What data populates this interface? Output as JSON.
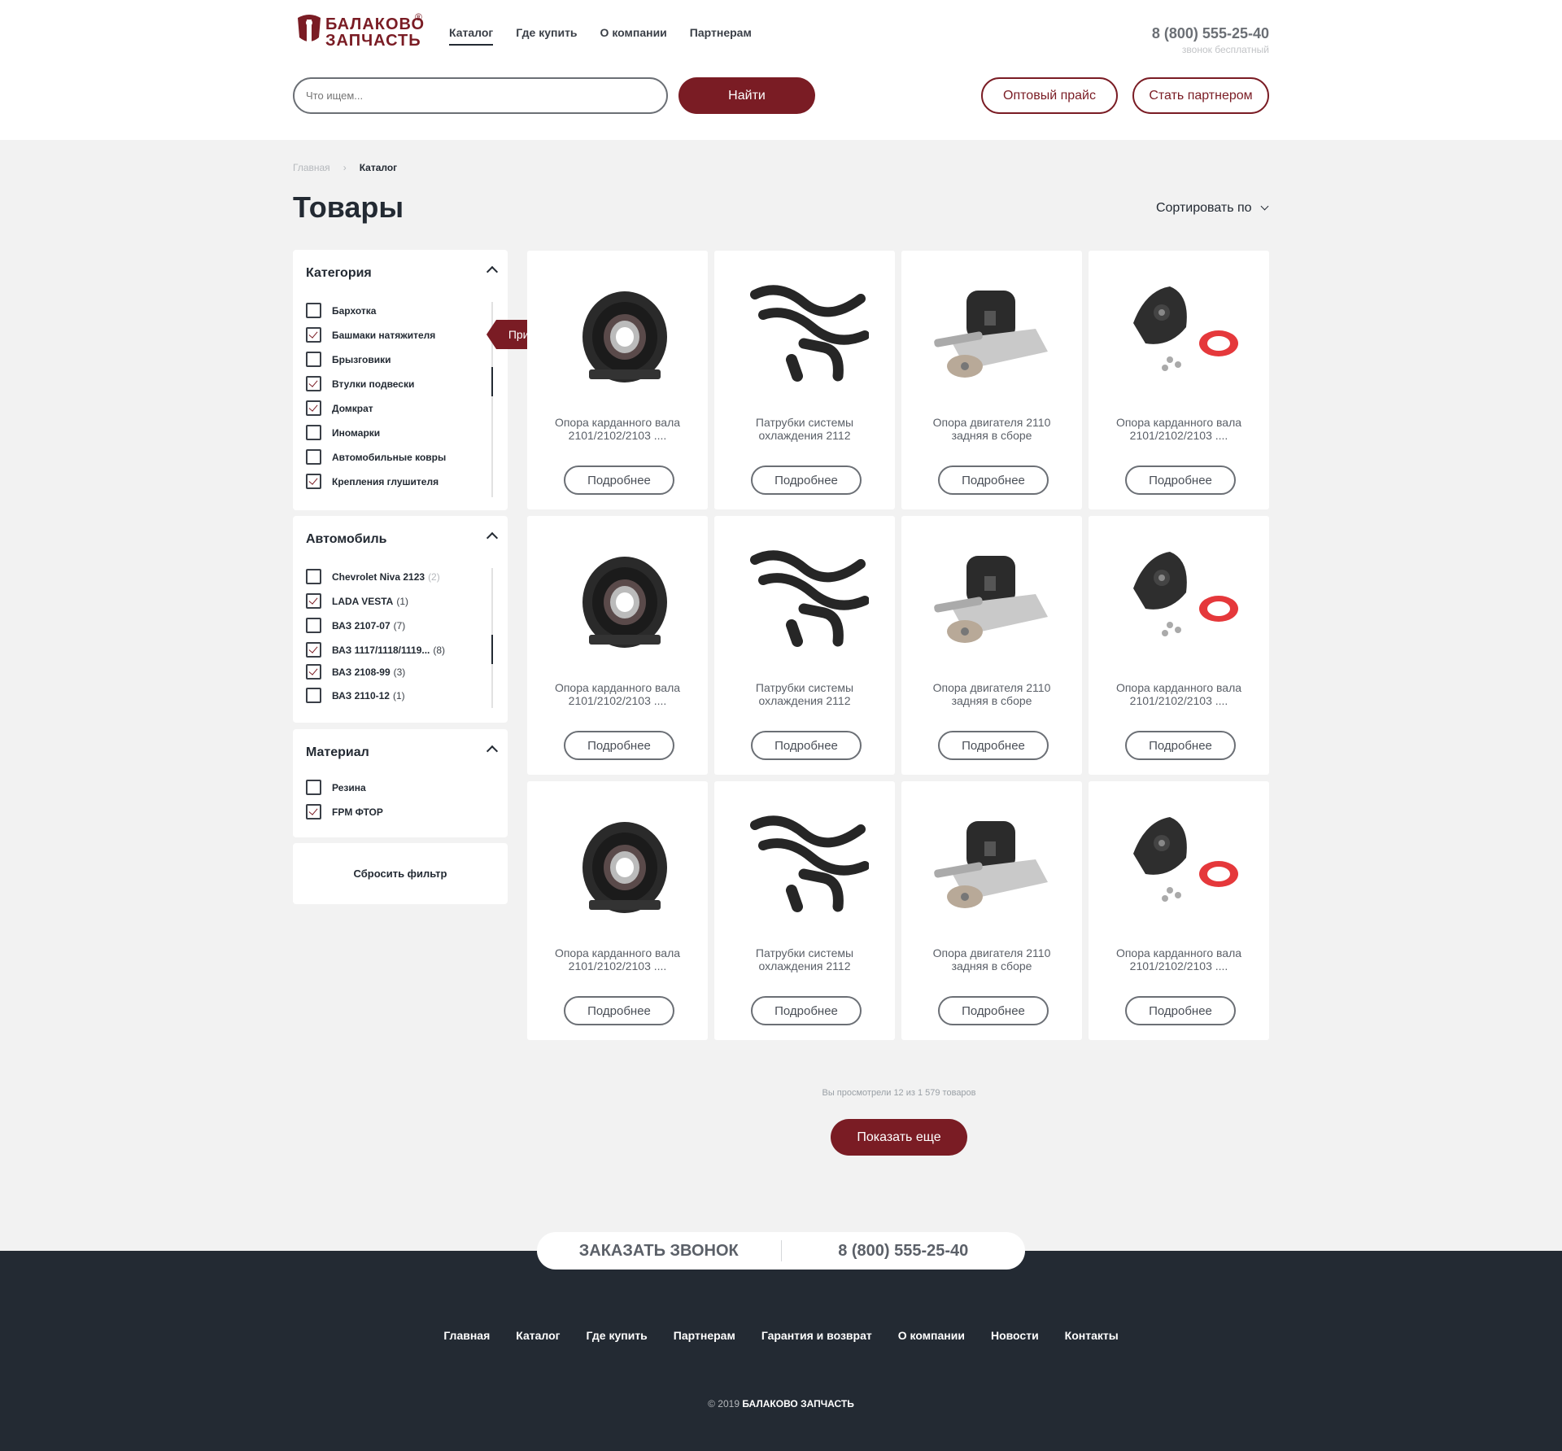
{
  "header": {
    "logo_line1": "БАЛАКОВО",
    "logo_line2": "ЗАПЧАСТЬ",
    "logo_reg": "®",
    "nav": [
      "Каталог",
      "Где купить",
      "О компании",
      "Партнерам"
    ],
    "phone": "8 (800) 555-25-40",
    "phone_note": "звонок бесплатный",
    "search_placeholder": "Что ищем...",
    "find_label": "Найти",
    "price_label": "Оптовый прайс",
    "partner_label": "Стать партнером"
  },
  "breadcrumb": {
    "home": "Главная",
    "sep": "›",
    "current": "Каталог"
  },
  "page_title": "Товары",
  "sort_label": "Сортировать по",
  "filters": {
    "category": {
      "title": "Категория",
      "items": [
        {
          "label": "Бархотка",
          "checked": false
        },
        {
          "label": "Башмаки натяжителя",
          "checked": true
        },
        {
          "label": "Брызговики",
          "checked": false
        },
        {
          "label": "Втулки подвески",
          "checked": true
        },
        {
          "label": "Домкрат",
          "checked": true
        },
        {
          "label": "Иномарки",
          "checked": false
        },
        {
          "label": "Автомобильные ковры",
          "checked": false
        },
        {
          "label": "Крепления глушителя",
          "checked": true
        }
      ]
    },
    "apply_label": "Применить",
    "car": {
      "title": "Автомобиль",
      "items": [
        {
          "label": "Chevrolet Niva 2123",
          "count": "(2)",
          "checked": false
        },
        {
          "label": "LADA VESTA",
          "count": "(1)",
          "checked": true
        },
        {
          "label": "ВАЗ 2107-07",
          "count": "(7)",
          "checked": false
        },
        {
          "label": "ВАЗ 1117/1118/1119...",
          "count": "(8)",
          "checked": true
        },
        {
          "label": "ВАЗ 2108-99",
          "count": "(3)",
          "checked": true
        },
        {
          "label": "ВАЗ 2110-12",
          "count": "(1)",
          "checked": false
        }
      ]
    },
    "material": {
      "title": "Материал",
      "items": [
        {
          "label": "Резина",
          "checked": false
        },
        {
          "label": "FPM ФТОР",
          "checked": true
        }
      ]
    },
    "reset_label": "Сбросить фильтр"
  },
  "products": [
    {
      "name1": "Опора карданного вала",
      "name2": "2101/2102/2103 ....",
      "image": "bearing-support"
    },
    {
      "name1": "Патрубки системы",
      "name2": "охлаждения 2112",
      "image": "hoses"
    },
    {
      "name1": "Опора двигателя 2110",
      "name2": "задняя в сборе",
      "image": "engine-mount"
    },
    {
      "name1": "Опора карданного вала",
      "name2": "2101/2102/2103 ....",
      "image": "strut-mount"
    },
    {
      "name1": "Опора карданного вала",
      "name2": "2101/2102/2103 ....",
      "image": "bearing-support"
    },
    {
      "name1": "Патрубки системы",
      "name2": "охлаждения 2112",
      "image": "hoses"
    },
    {
      "name1": "Опора двигателя 2110",
      "name2": "задняя в сборе",
      "image": "engine-mount"
    },
    {
      "name1": "Опора карданного вала",
      "name2": "2101/2102/2103 ....",
      "image": "strut-mount"
    },
    {
      "name1": "Опора карданного вала",
      "name2": "2101/2102/2103 ....",
      "image": "bearing-support"
    },
    {
      "name1": "Патрубки системы",
      "name2": "охлаждения 2112",
      "image": "hoses"
    },
    {
      "name1": "Опора двигателя 2110",
      "name2": "задняя в сборе",
      "image": "engine-mount"
    },
    {
      "name1": "Опора карданного вала",
      "name2": "2101/2102/2103 ....",
      "image": "strut-mount"
    }
  ],
  "more_label": "Подробнее",
  "viewed_text": "Вы просмотрели 12 из 1 579 товаров",
  "show_more_label": "Показать еще",
  "callbar": {
    "order": "ЗАКАЗАТЬ ЗВОНОК",
    "phone": "8 (800) 555-25-40"
  },
  "footer": {
    "nav": [
      "Главная",
      "Каталог",
      "Где купить",
      "Партнерам",
      "Гарантия и возврат",
      "О компании",
      "Новости",
      "Контакты"
    ],
    "copyright": "© 2019",
    "brand": "БАЛАКОВО ЗАПЧАСТЬ"
  },
  "colors": {
    "accent": "#7a1c24",
    "dark": "#232a33",
    "bg": "#f2f2f2"
  }
}
